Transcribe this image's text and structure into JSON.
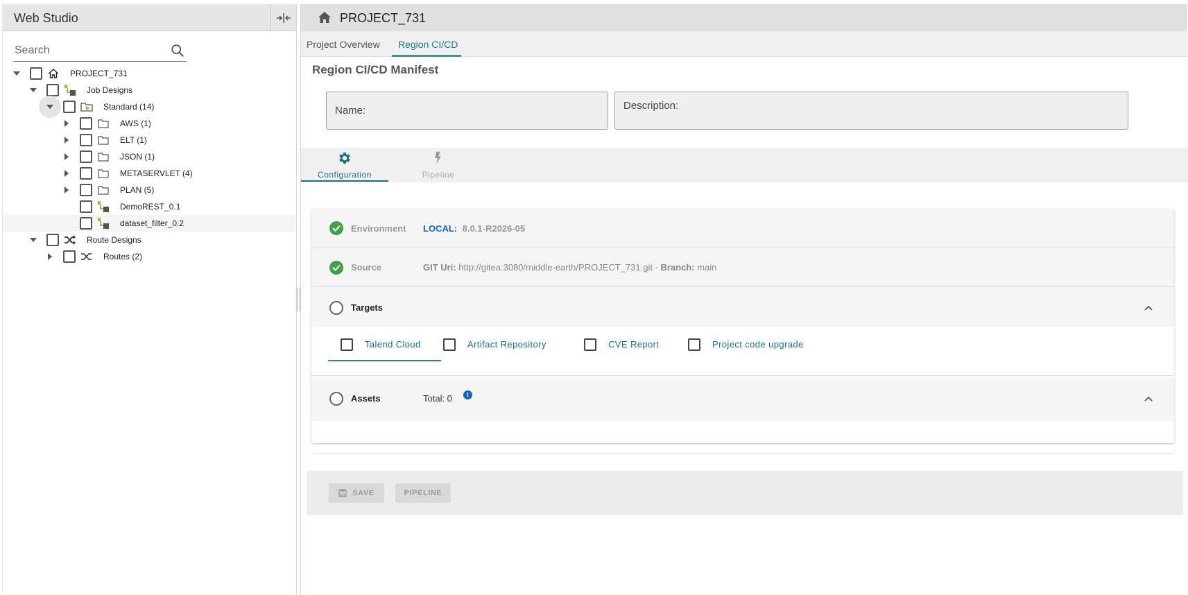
{
  "app": {
    "title": "Web Studio"
  },
  "search": {
    "placeholder": "Search"
  },
  "tree": {
    "root": {
      "label": "PROJECT_731"
    },
    "job_designs": {
      "label": "Job Designs"
    },
    "standard": {
      "label": "Standard (14)"
    },
    "folders": [
      {
        "label": "AWS (1)"
      },
      {
        "label": "ELT (1)"
      },
      {
        "label": "JSON (1)"
      },
      {
        "label": "METASERVLET (4)"
      },
      {
        "label": "PLAN (5)"
      }
    ],
    "jobs": [
      {
        "label": "DemoREST_0.1"
      },
      {
        "label": "dataset_filter_0.2"
      }
    ],
    "route_designs": {
      "label": "Route Designs"
    },
    "routes": {
      "label": "Routes (2)"
    }
  },
  "header": {
    "project": "PROJECT_731"
  },
  "tabs": [
    {
      "label": "Project Overview"
    },
    {
      "label": "Region CI/CD"
    }
  ],
  "manifest": {
    "title": "Region CI/CD Manifest",
    "name_label": "Name:",
    "description_label": "Description:"
  },
  "subtabs": [
    {
      "label": "Configuration",
      "icon": "gear-icon"
    },
    {
      "label": "Pipeline",
      "icon": "lightning-icon"
    }
  ],
  "config": {
    "environment": {
      "label": "Environment",
      "key": "LOCAL:",
      "value": "8.0.1-R2026-05"
    },
    "source": {
      "label": "Source",
      "uri_key": "GIT Uri:",
      "uri": "http://gitea:3080/middle-earth/PROJECT_731.git",
      "sep": "-",
      "branch_key": "Branch:",
      "branch": "main"
    },
    "targets": {
      "label": "Targets",
      "items": [
        {
          "label": "Talend Cloud"
        },
        {
          "label": "Artifact Repository"
        },
        {
          "label": "CVE Report"
        },
        {
          "label": "Project code upgrade"
        }
      ]
    },
    "assets": {
      "label": "Assets",
      "total": "Total: 0"
    }
  },
  "footer": {
    "save_label": "SAVE",
    "pipeline_label": "PIPELINE"
  },
  "colors": {
    "accent": "#1f7a8c",
    "success": "#43a047",
    "info": "#1565c0"
  }
}
